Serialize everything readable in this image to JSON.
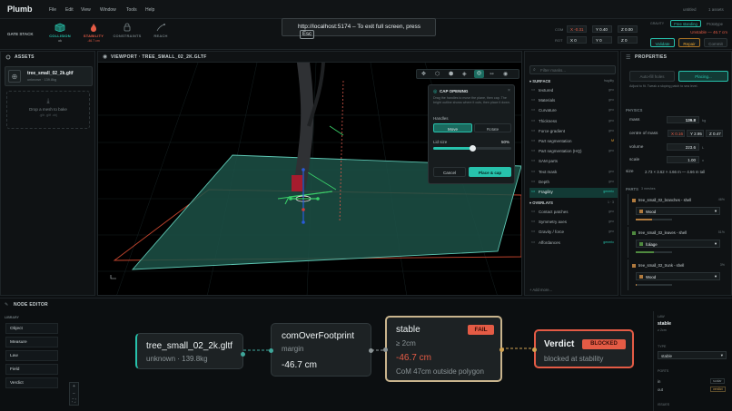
{
  "app": {
    "name": "Plumb",
    "menu": [
      "File",
      "Edit",
      "View",
      "Window",
      "Tools",
      "Help"
    ],
    "doc_title": "untitled",
    "doc_status": "1 assets"
  },
  "gate_stack": {
    "label": "GATE STACK",
    "items": [
      {
        "label": "COLLISION",
        "sub": "ok",
        "color": "#27c2ac"
      },
      {
        "label": "STABILITY",
        "sub": "-46.7 cm",
        "color": "#e45b45"
      },
      {
        "label": "CONSTRAINTS",
        "sub": "",
        "color": "#7a8588"
      },
      {
        "label": "REACH",
        "sub": "",
        "color": "#7a8588"
      }
    ]
  },
  "fullscreen": {
    "text": "http://localhost:5174 – To exit full screen, press",
    "key": "Esc"
  },
  "transform": {
    "rows": [
      {
        "label": "COM",
        "x": "X -0.31",
        "y": "Y 0.40",
        "z": "Z 0.00"
      },
      {
        "label": "ROT",
        "x": "X 0",
        "y": "Y 0",
        "z": "Z 0"
      }
    ]
  },
  "status": {
    "mode_label": "GRAVITY",
    "mode": "Free standing",
    "mode2": "Prototype",
    "error_label": "Unstable",
    "error": "Unstable — 46.7 cm",
    "validate": "Validate",
    "repair": "Repair",
    "commit": "Commit"
  },
  "assets": {
    "title": "ASSETS",
    "items": [
      {
        "name": "tree_small_02_2k.gltf",
        "sub": "unknown · 139.8kg"
      }
    ],
    "drop_text": "Drop a mesh to bake",
    "drop_sub": ".glb .gltf .obj"
  },
  "viewport": {
    "title": "VIEWPORT · TREE_SMALL_02_2K.GLTF"
  },
  "cap": {
    "title": "CAP OPENING",
    "desc": "Drag the handles to move the plane, then cap. The bright outline shows where it cuts, then place it down.",
    "handles_label": "Handles",
    "move": "Move",
    "rotate": "Rotate",
    "lid_label": "Lid size",
    "lid_value": "50%",
    "lid_pct": 50,
    "cancel": "Cancel",
    "place": "Place & cap"
  },
  "maps": {
    "filter_placeholder": "Filter masks...",
    "surface_label": "SURFACE",
    "surface_tag": "fragility",
    "overlays_label": "OVERLAYS",
    "overlays_tag": "1 · 3",
    "add_label": "Add more...",
    "surface": [
      {
        "name": "textured",
        "tag": "geo"
      },
      {
        "name": "Materials",
        "tag": "geo"
      },
      {
        "name": "Curvature",
        "tag": "geo"
      },
      {
        "name": "Thickness",
        "tag": "geo"
      },
      {
        "name": "Force gradient",
        "tag": "geo"
      },
      {
        "name": "Part segmentation",
        "tag": "M"
      },
      {
        "name": "Part segmentation (HQ)",
        "tag": "geo"
      },
      {
        "name": "SAM parts",
        "tag": ""
      },
      {
        "name": "Text mask",
        "tag": "geo"
      },
      {
        "name": "Depth",
        "tag": "geo"
      },
      {
        "name": "Fragility",
        "tag": "generic",
        "active": true
      }
    ],
    "overlays": [
      {
        "name": "Contact patches",
        "tag": "geo"
      },
      {
        "name": "Symmetry axes",
        "tag": "geo"
      },
      {
        "name": "Gravity / force",
        "tag": "geo"
      },
      {
        "name": "Affordances",
        "tag": "generic"
      }
    ]
  },
  "properties": {
    "title": "PROPERTIES",
    "b1": "Auto-fill holes",
    "b2": "Placing...",
    "note": "Adjust to fit. Tweak a sloping patch to sea level.",
    "physics_label": "PHYSICS",
    "mass_label": "mass",
    "mass": "139.8",
    "mass_unit": "kg",
    "com_label": "centre of mass",
    "com": [
      "X 0.16",
      "Y 2.95",
      "Z 0.47"
    ],
    "volume_label": "volume",
    "volume": "223.6",
    "volume_unit": "L",
    "scale_label": "scale",
    "scale": "1.00",
    "scale_unit": "x",
    "size_label": "size",
    "size": "2.73 × 3.62 × 4.66 m — 4.66 m tall",
    "parts_label": "PARTS",
    "parts_count": "3 meshes",
    "parts": [
      {
        "name": "tree_small_02_branches - shell",
        "pct": "46%",
        "material": "Wood",
        "color": "#b07a3e"
      },
      {
        "name": "tree_small_02_leaves - shell",
        "pct": "51%",
        "material": "foliage",
        "color": "#4f8a3f"
      },
      {
        "name": "tree_small_02_trunk - shell",
        "pct": "3%",
        "material": "Wood",
        "color": "#b07a3e"
      }
    ]
  },
  "node_editor": {
    "title": "NODE EDITOR",
    "library_label": "LIBRARY",
    "library": [
      "Object",
      "Measure",
      "Law",
      "Field",
      "Verdict"
    ],
    "nodes": [
      {
        "title": "tree_small_02_2k.gltf",
        "sub": "unknown · 139.8kg"
      },
      {
        "title": "comOverFootprint",
        "sub": "margin",
        "value": "-46.7 cm"
      },
      {
        "title": "stable",
        "badge": "FAIL",
        "sub": "≥ 2cm",
        "value": "-46.7 cm",
        "note": "CoM 47cm outside polygon"
      },
      {
        "title": "Verdict",
        "badge": "BLOCKED",
        "sub": "blocked at stability"
      }
    ],
    "side": {
      "law_label": "LAW",
      "law": "stable",
      "law_sub": "≥ 2cm",
      "type_label": "TYPE",
      "type": "stable",
      "ports_label": "PORTS",
      "port_in": "in",
      "port_in_tag": "scalar",
      "port_out": "out",
      "port_out_tag": "verdict",
      "issues_label": "ISSUES"
    }
  },
  "colors": {
    "accent": "#27c2ac",
    "fail": "#e45b45",
    "blocked_border": "#e45b45",
    "stable_border": "#c9b48d"
  }
}
